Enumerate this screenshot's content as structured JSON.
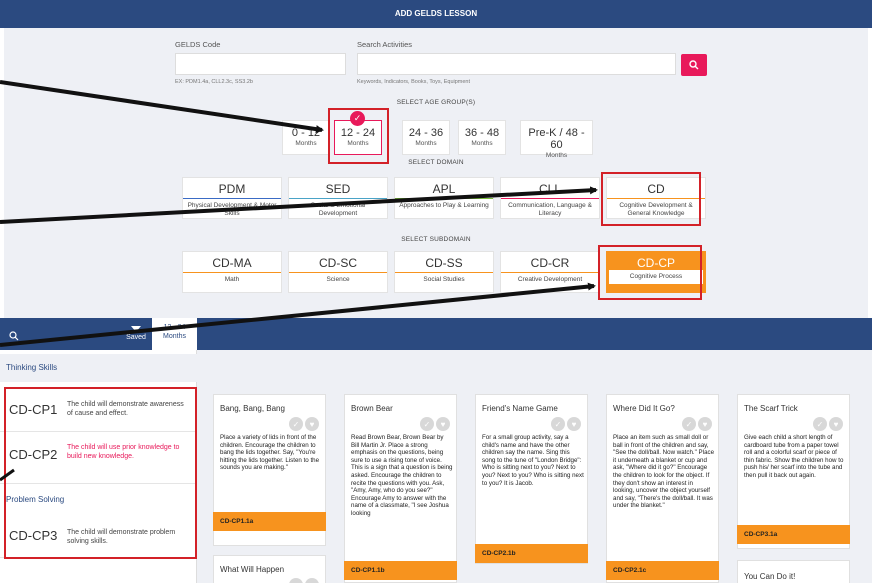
{
  "modal": {
    "title": "ADD GELDS LESSON",
    "gelds_code_label": "GELDS Code",
    "gelds_code_hint": "EX: PDM1.4a, CLL2.3c, SS3.2b",
    "search_label": "Search Activities",
    "search_hint": "Keywords, Indicators, Books, Toys, Equipment",
    "age_title": "SELECT AGE GROUP(S)",
    "domain_title": "SELECT DOMAIN",
    "subdomain_title": "SELECT SUBDOMAIN"
  },
  "ages": [
    {
      "range": "0 - 12",
      "unit": "Months"
    },
    {
      "range": "12 - 24",
      "unit": "Months"
    },
    {
      "range": "24 - 36",
      "unit": "Months"
    },
    {
      "range": "36 - 48",
      "unit": "Months"
    },
    {
      "range": "Pre-K / 48 - 60",
      "unit": "Months"
    }
  ],
  "domains": [
    {
      "code": "PDM",
      "desc": "Physical Development & Motor Skills",
      "color": "#3a6bc5"
    },
    {
      "code": "SED",
      "desc": "Social & Emotional Development",
      "color": "#4aa3c7"
    },
    {
      "code": "APL",
      "desc": "Approaches to Play & Learning",
      "color": "#7bbf3b"
    },
    {
      "code": "CLL",
      "desc": "Communication, Language & Literacy",
      "color": "#e8195a"
    },
    {
      "code": "CD",
      "desc": "Cognitive Development & General Knowledge",
      "color": "#f7931e"
    }
  ],
  "subdomains": [
    {
      "code": "CD-MA",
      "desc": "Math"
    },
    {
      "code": "CD-SC",
      "desc": "Science"
    },
    {
      "code": "CD-SS",
      "desc": "Social Studies"
    },
    {
      "code": "CD-CR",
      "desc": "Creative Development"
    },
    {
      "code": "CD-CP",
      "desc": "Cognitive Process"
    }
  ],
  "tabs": {
    "saved": "Saved",
    "age_range": "12 - 24",
    "age_unit": "Months"
  },
  "sidebar": {
    "group1": "Thinking Skills",
    "group2": "Problem Solving",
    "items": [
      {
        "code": "CD-CP1",
        "desc": "The child will demonstrate awareness of cause and effect."
      },
      {
        "code": "CD-CP2",
        "desc": "The child will use prior knowledge to build new knowledge."
      },
      {
        "code": "CD-CP3",
        "desc": "The child will demonstrate problem solving skills."
      }
    ]
  },
  "cards": [
    {
      "title": "Bang, Bang, Bang",
      "body": "Place a variety of lids in front of the children. Encourage the children to bang the lids together. Say, \"You're hitting the lids together. Listen to the sounds you are making.\"",
      "code": "CD-CP1.1a"
    },
    {
      "title": "Brown Bear",
      "body": "Read Brown Bear, Brown Bear by Bill Martin Jr. Place a strong emphasis on the questions, being sure to use a rising tone of voice. This is a sign that a question is being asked. Encourage the children to recite the questions with you. Ask, \"Amy, Amy, who do you see?\" Encourage Amy to answer with the name of a classmate, \"I see Joshua looking",
      "code": "CD-CP1.1b"
    },
    {
      "title": "Friend's Name Game",
      "body": "For a small group activity, say a child's name and have the other children say the name. Sing this song to the tune of \"London Bridge\": Who is sitting next to you? Next to you? Next to you? Who is sitting next to you? It is Jacob.",
      "code": "CD-CP2.1b"
    },
    {
      "title": "Where Did It Go?",
      "body": "Place an item such as small doll or ball in front of the children and say, \"See the doll/ball. Now watch.\" Place it underneath a blanket or cup and ask, \"Where did it go?\" Encourage the children to look for the object. If they don't show an interest in looking, uncover the object yourself and say, \"There's the doll/ball. It was under the blanket.\"",
      "code": "CD-CP2.1c"
    },
    {
      "title": "The Scarf Trick",
      "body": "Give each child a short length of cardboard tube from a paper towel roll and a colorful scarf or piece of thin fabric. Show the children how to push his/ her scarf into the tube and then pull it back out again.",
      "code": "CD-CP3.1a"
    },
    {
      "title": "What Will Happen",
      "body": "",
      "code": ""
    },
    {
      "title": "You Can Do it!",
      "body": "",
      "code": ""
    }
  ]
}
